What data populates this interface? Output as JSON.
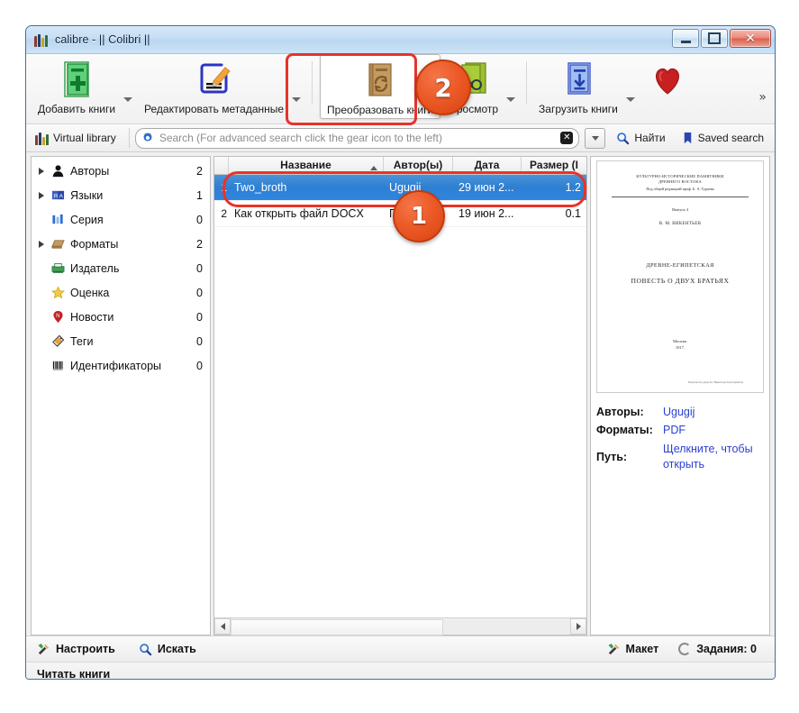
{
  "window": {
    "title": "calibre - || Colibri ||",
    "controls": {
      "minimize": "Minimize",
      "maximize": "Maximize",
      "close": "✕"
    }
  },
  "toolbar": {
    "items": [
      {
        "label": "Добавить книги",
        "icon": "add-book-icon",
        "has_caret": true
      },
      {
        "label": "Редактировать метаданные",
        "icon": "edit-metadata-icon",
        "has_caret": true
      },
      {
        "label": "Преобразовать книги",
        "icon": "convert-book-icon",
        "has_caret": false
      },
      {
        "label": "Просмотр",
        "icon": "view-book-icon",
        "has_caret": true
      },
      {
        "label": "Загрузить книги",
        "icon": "download-book-icon",
        "has_caret": true
      },
      {
        "label": "",
        "icon": "heart-icon",
        "has_caret": false
      }
    ],
    "overflow": "»"
  },
  "search": {
    "virtual_library": "Virtual library",
    "virtual_library_icon": "books-icon",
    "gear_icon": "gear-icon",
    "placeholder": "Search (For advanced search click the gear icon to the left)",
    "value": "",
    "clear_icon": "clear-icon",
    "dropdown_icon": "chevron-down-icon",
    "find_label": "Найти",
    "find_icon": "search-icon",
    "saved_search_label": "Saved search",
    "saved_search_icon": "bookmark-icon"
  },
  "sidebar": {
    "items": [
      {
        "label": "Авторы",
        "count": "2",
        "icon": "person-icon",
        "expandable": true
      },
      {
        "label": "Языки",
        "count": "1",
        "icon": "language-icon",
        "expandable": true
      },
      {
        "label": "Серия",
        "count": "0",
        "icon": "series-icon",
        "expandable": false
      },
      {
        "label": "Форматы",
        "count": "2",
        "icon": "formats-icon",
        "expandable": true
      },
      {
        "label": "Издатель",
        "count": "0",
        "icon": "publisher-icon",
        "expandable": false
      },
      {
        "label": "Оценка",
        "count": "0",
        "icon": "star-icon",
        "expandable": false
      },
      {
        "label": "Новости",
        "count": "0",
        "icon": "news-icon",
        "expandable": false
      },
      {
        "label": "Теги",
        "count": "0",
        "icon": "tag-icon",
        "expandable": false
      },
      {
        "label": "Идентификаторы",
        "count": "0",
        "icon": "barcode-icon",
        "expandable": false
      }
    ],
    "bottom": {
      "configure_label": "Настроить",
      "configure_icon": "tools-icon",
      "search_label": "Искать",
      "search_icon": "search-icon"
    }
  },
  "table": {
    "columns": [
      {
        "label": "Название",
        "sorted": true,
        "sort_dir": "asc"
      },
      {
        "label": "Автор(ы)",
        "sorted": false
      },
      {
        "label": "Дата",
        "sorted": false
      },
      {
        "label": "Размер (I",
        "sorted": false
      }
    ],
    "rows": [
      {
        "num": "1",
        "title": "Two_broth",
        "author": "Ugugij",
        "date": "29 июн 2...",
        "size": "1.2",
        "selected": true
      },
      {
        "num": "2",
        "title": "Как открыть файл DOCX",
        "author": "П",
        "date": "19 июн 2...",
        "size": "0.1",
        "selected": false
      }
    ]
  },
  "detail": {
    "cover": {
      "header_line1": "КУЛЬТУРНО-ИСТОРИЧЕСКИЕ ПАМЯТНИКИ",
      "header_line2": "ДРЕВНЕГО ВОСТОКА",
      "editor": "Под общей редакцией проф. Б. А. Тураева",
      "issue": "Выпуск 4",
      "author": "В. М. ВИКЕНТЬЕВ",
      "title_line1": "ДРЕВНЕ-ЕГИПЕТСКАЯ",
      "title_line2": "ПОВЕСТЬ О ДВУХ БРАТЬЯХ",
      "city": "Москва.",
      "year": "1917.",
      "fineprint": "Издательство  дворе  Б.г.  Викентьева  Трехгорный пр."
    },
    "fields": [
      {
        "key": "Авторы:",
        "value": "Ugugij"
      },
      {
        "key": "Форматы:",
        "value": "PDF"
      },
      {
        "key": "Путь:",
        "value": "Щелкните, чтобы открыть"
      }
    ]
  },
  "bottom": {
    "layout_label": "Макет",
    "layout_icon": "tools-icon",
    "jobs_label": "Задания: 0",
    "jobs_icon": "spinner-icon"
  },
  "statusbar": {
    "text": "Читать книги"
  },
  "annotations": [
    {
      "number": "1"
    },
    {
      "number": "2"
    }
  ],
  "colors": {
    "selection_blue": "#2d7fd2",
    "highlight_red": "#e8332a",
    "badge_orange": "#ec5a28",
    "link_blue": "#2b3fd0"
  }
}
